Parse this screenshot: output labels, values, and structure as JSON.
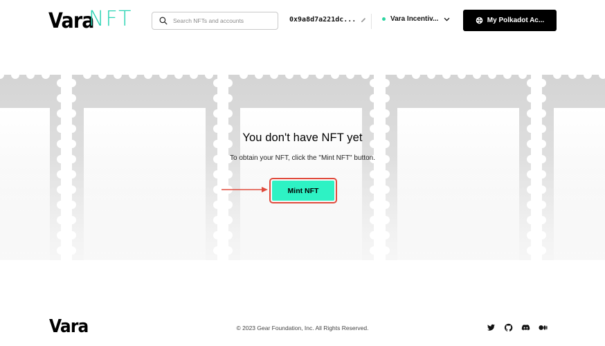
{
  "header": {
    "logo_primary": "Vara",
    "logo_secondary": "NFT",
    "search_placeholder": "Search NFTs and accounts",
    "search_value": "",
    "address": "0x9a8d7a221dc...",
    "network_name": "Vara Incentiv...",
    "account_button_label": "My Polkadot Ac..."
  },
  "main": {
    "empty_title": "You don't have NFT yet",
    "empty_description": "To obtain your NFT, click the \"Mint NFT\" button.",
    "mint_button_label": "Mint NFT"
  },
  "footer": {
    "logo": "Vara",
    "copyright": "© 2023 Gear Foundation, Inc. All Rights Reserved.",
    "social_icons": [
      "twitter-icon",
      "github-icon",
      "discord-icon",
      "medium-icon"
    ]
  },
  "colors": {
    "accent": "#2ef2c4",
    "logo_accent": "#2bd4b4",
    "highlight": "#e04a3c",
    "stamp": "#d6d6d6",
    "button_dark": "#000000"
  }
}
